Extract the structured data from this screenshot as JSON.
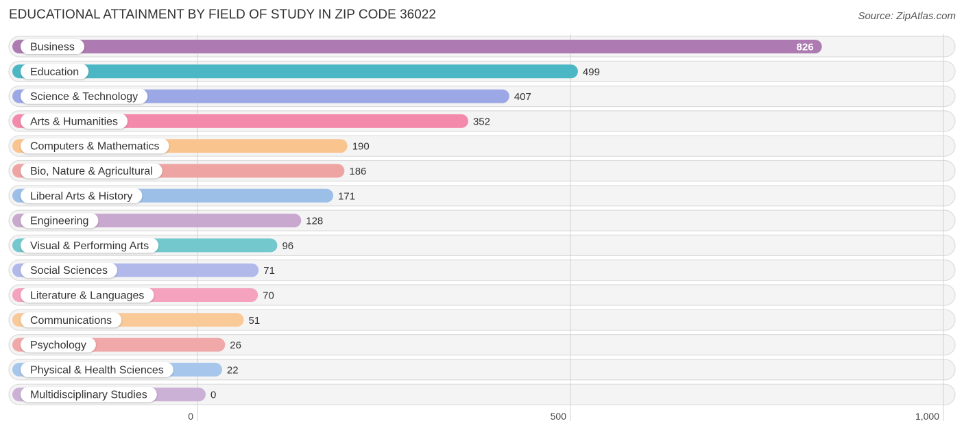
{
  "chart_data": {
    "type": "bar",
    "orientation": "horizontal",
    "title": "EDUCATIONAL ATTAINMENT BY FIELD OF STUDY IN ZIP CODE 36022",
    "source": "Source: ZipAtlas.com",
    "xlabel": "",
    "ylabel": "",
    "xlim": [
      0,
      1000
    ],
    "x_ticks": [
      0,
      500,
      1000
    ],
    "x_tick_labels": [
      "0",
      "500",
      "1,000"
    ],
    "grid": true,
    "categories": [
      "Business",
      "Education",
      "Science & Technology",
      "Arts & Humanities",
      "Computers & Mathematics",
      "Bio, Nature & Agricultural",
      "Liberal Arts & History",
      "Engineering",
      "Visual & Performing Arts",
      "Social Sciences",
      "Literature & Languages",
      "Communications",
      "Psychology",
      "Physical & Health Sciences",
      "Multidisciplinary Studies"
    ],
    "values": [
      826,
      499,
      407,
      352,
      190,
      186,
      171,
      128,
      96,
      71,
      70,
      51,
      26,
      22,
      0
    ],
    "value_labels": [
      "826",
      "499",
      "407",
      "352",
      "190",
      "186",
      "171",
      "128",
      "96",
      "71",
      "70",
      "51",
      "26",
      "22",
      "0"
    ],
    "colors": [
      "#ad7bb1",
      "#4bb7c4",
      "#9ca8e6",
      "#f48aab",
      "#f9c48e",
      "#eea4a3",
      "#9cbfe7",
      "#c9a8cf",
      "#72c8cc",
      "#b1b9ea",
      "#f5a2bf",
      "#f9c998",
      "#f0a9a8",
      "#a6c7eb",
      "#cbb1d6"
    ]
  }
}
